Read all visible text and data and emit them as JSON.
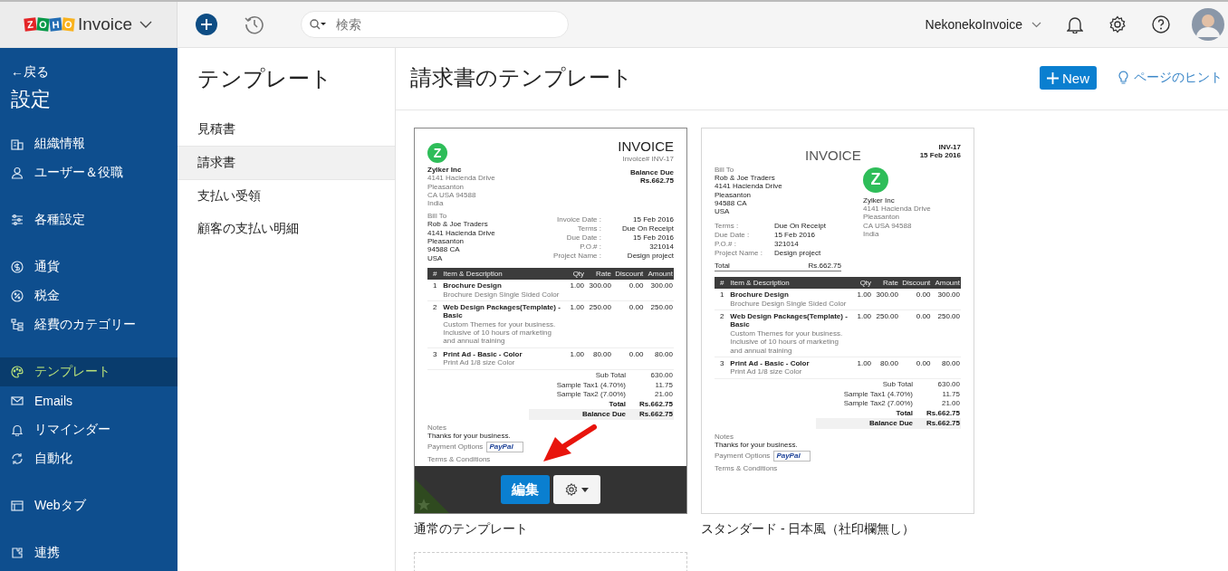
{
  "app": {
    "logo_letters": [
      "Z",
      "O",
      "H",
      "O"
    ],
    "name": "Invoice"
  },
  "topbar": {
    "search_placeholder": "検索",
    "organization": "NekonekoInvoice"
  },
  "sidebar": {
    "back": "←戻る",
    "title": "設定",
    "groups": [
      [
        {
          "label": "組織情報",
          "selected": false
        },
        {
          "label": "ユーザー＆役職",
          "selected": false
        }
      ],
      [
        {
          "label": "各種設定",
          "selected": false
        }
      ],
      [
        {
          "label": "通貨",
          "selected": false
        },
        {
          "label": "税金",
          "selected": false
        },
        {
          "label": "経費のカテゴリー",
          "selected": false
        }
      ],
      [
        {
          "label": "テンプレート",
          "selected": true
        },
        {
          "label": "Emails",
          "selected": false
        },
        {
          "label": "リマインダー",
          "selected": false
        },
        {
          "label": "自動化",
          "selected": false
        }
      ],
      [
        {
          "label": "Webタブ",
          "selected": false
        }
      ],
      [
        {
          "label": "連携",
          "selected": false
        }
      ]
    ]
  },
  "subnav": {
    "title": "テンプレート",
    "items": [
      {
        "label": "見積書",
        "selected": false
      },
      {
        "label": "請求書",
        "selected": true
      },
      {
        "label": "支払い受領",
        "selected": false
      },
      {
        "label": "顧客の支払い明細",
        "selected": false
      }
    ]
  },
  "main": {
    "title": "請求書のテンプレート",
    "new_button": "New",
    "hint": "ページのヒント"
  },
  "templates": [
    {
      "kind": "standard",
      "name": "通常のテンプレート",
      "hover": true,
      "default": true,
      "edit_button": "編集",
      "preview": {
        "title": "INVOICE",
        "number": "Invoice# INV-17",
        "balance_label": "Balance Due",
        "balance": "Rs.662.75",
        "company": {
          "logo": "Z",
          "name": "Zylker Inc",
          "lines": [
            "4141 Hacienda Drive",
            "Pleasanton",
            "CA USA 94588",
            "India"
          ]
        },
        "bill_to": {
          "label": "Bill To",
          "lines": [
            "Rob & Joe Traders",
            "4141 Hacienda Drive",
            "Pleasanton",
            "94588 CA",
            "USA"
          ]
        },
        "meta": [
          {
            "label": "Invoice Date :",
            "value": "15 Feb 2016"
          },
          {
            "label": "Terms :",
            "value": "Due On Receipt"
          },
          {
            "label": "Due Date :",
            "value": "15 Feb 2016"
          },
          {
            "label": "P.O.# :",
            "value": "321014"
          },
          {
            "label": "Project Name :",
            "value": "Design project"
          }
        ],
        "columns": [
          "#",
          "Item & Description",
          "Qty",
          "Rate",
          "Discount",
          "Amount"
        ],
        "rows": [
          {
            "no": "1",
            "item": "Brochure Design",
            "desc": "Brochure Design Single Sided Color",
            "qty": "1.00",
            "rate": "300.00",
            "discount": "0.00",
            "amount": "300.00"
          },
          {
            "no": "2",
            "item": "Web Design Packages(Template) - Basic",
            "desc": "Custom Themes for your business. Inclusive of 10 hours of marketing and annual training",
            "qty": "1.00",
            "rate": "250.00",
            "discount": "0.00",
            "amount": "250.00"
          },
          {
            "no": "3",
            "item": "Print Ad - Basic - Color",
            "desc": "Print Ad 1/8 size Color",
            "qty": "1.00",
            "rate": "80.00",
            "discount": "0.00",
            "amount": "80.00"
          }
        ],
        "totals": [
          {
            "kind": "normal",
            "label": "Sub Total",
            "value": "630.00"
          },
          {
            "kind": "normal",
            "label": "Sample Tax1 (4.70%)",
            "value": "11.75"
          },
          {
            "kind": "normal",
            "label": "Sample Tax2 (7.00%)",
            "value": "21.00"
          },
          {
            "kind": "total",
            "label": "Total",
            "value": "Rs.662.75"
          },
          {
            "kind": "balance",
            "label": "Balance Due",
            "value": "Rs.662.75"
          }
        ],
        "notes_label": "Notes",
        "notes": "Thanks for your business.",
        "payment_label": "Payment Options",
        "payment_badge": "PayPal",
        "terms_label": "Terms & Conditions"
      }
    },
    {
      "kind": "japanese",
      "name": "スタンダード - 日本風（社印欄無し）",
      "hover": false,
      "default": false,
      "preview": {
        "title": "INVOICE",
        "number": "INV-17",
        "date": "15 Feb 2016",
        "total_label": "Total",
        "total": "Rs.662.75",
        "company": {
          "logo": "Z",
          "name": "Zylker Inc",
          "lines": [
            "4141 Hacienda Drive",
            "Pleasanton",
            "CA USA 94588",
            "India"
          ]
        },
        "bill_to": {
          "label": "Bill To",
          "lines": [
            "Rob & Joe Traders",
            "4141 Hacienda Drive",
            "Pleasanton",
            "94588 CA",
            "USA"
          ]
        },
        "meta": [
          {
            "label": "Terms :",
            "value": "Due On Receipt"
          },
          {
            "label": "Due Date :",
            "value": "15 Feb 2016"
          },
          {
            "label": "P.O.# :",
            "value": "321014"
          },
          {
            "label": "Project Name :",
            "value": "Design project"
          }
        ],
        "columns": [
          "#",
          "Item & Description",
          "Qty",
          "Rate",
          "Discount",
          "Amount"
        ],
        "rows": [
          {
            "no": "1",
            "item": "Brochure Design",
            "desc": "Brochure Design Single Sided Color",
            "qty": "1.00",
            "rate": "300.00",
            "discount": "0.00",
            "amount": "300.00"
          },
          {
            "no": "2",
            "item": "Web Design Packages(Template) - Basic",
            "desc": "Custom Themes for your business. Inclusive of 10 hours of marketing and annual training",
            "qty": "1.00",
            "rate": "250.00",
            "discount": "0.00",
            "amount": "250.00"
          },
          {
            "no": "3",
            "item": "Print Ad - Basic - Color",
            "desc": "Print Ad 1/8 size Color",
            "qty": "1.00",
            "rate": "80.00",
            "discount": "0.00",
            "amount": "80.00"
          }
        ],
        "totals": [
          {
            "kind": "normal",
            "label": "Sub Total",
            "value": "630.00"
          },
          {
            "kind": "normal",
            "label": "Sample Tax1 (4.70%)",
            "value": "11.75"
          },
          {
            "kind": "normal",
            "label": "Sample Tax2 (7.00%)",
            "value": "21.00"
          },
          {
            "kind": "total",
            "label": "Total",
            "value": "Rs.662.75"
          },
          {
            "kind": "balance",
            "label": "Balance Due",
            "value": "Rs.662.75"
          }
        ],
        "notes_label": "Notes",
        "notes": "Thanks for your business.",
        "payment_label": "Payment Options",
        "payment_badge": "PayPal",
        "terms_label": "Terms & Conditions"
      }
    },
    {
      "kind": "placeholder"
    }
  ]
}
